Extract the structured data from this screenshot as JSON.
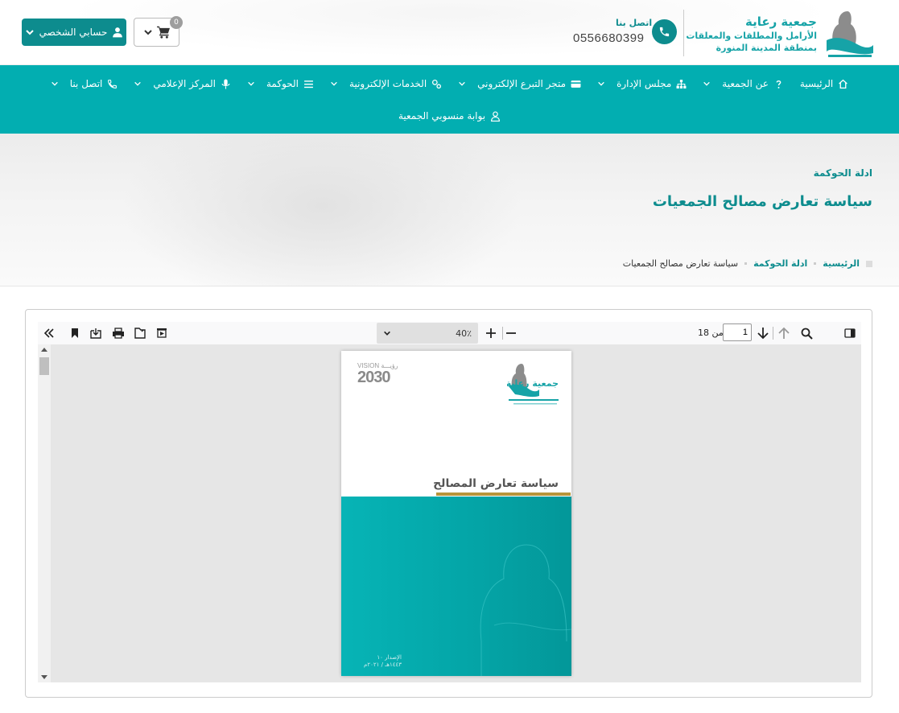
{
  "header": {
    "logo": {
      "title": "جمعية رعاية",
      "subtitle_line1": "الأرامل والمطلقات والمعلقات",
      "subtitle_line2": "بمنطقة المدينة المنورة"
    },
    "contact_label": "اتصل بنا",
    "contact_phone": "0556680399",
    "cart_count": "0",
    "account_label": "حسابي الشخصي"
  },
  "nav": {
    "row1": [
      {
        "label": "الرئيسية",
        "icon": "home-icon",
        "has_dropdown": false
      },
      {
        "label": "عن الجمعية",
        "icon": "question-icon",
        "has_dropdown": true
      },
      {
        "label": "مجلس الإدارة",
        "icon": "sitemap-icon",
        "has_dropdown": true
      },
      {
        "label": "متجر التبرع الإلكتروني",
        "icon": "card-icon",
        "has_dropdown": true
      },
      {
        "label": "الخدمات الإلكترونية",
        "icon": "gears-icon",
        "has_dropdown": true
      },
      {
        "label": "الحوكمة",
        "icon": "list-icon",
        "has_dropdown": true
      },
      {
        "label": "المركز الإعلامي",
        "icon": "mic-icon",
        "has_dropdown": true
      },
      {
        "label": "اتصل بنا",
        "icon": "phone-icon",
        "has_dropdown": true
      }
    ],
    "row2": [
      {
        "label": "بوابة منسوبي الجمعية",
        "icon": "user-icon",
        "has_dropdown": false
      }
    ]
  },
  "hero": {
    "category": "ادلة الحوكمة",
    "title": "سياسة تعارض مصالح الجمعيات",
    "breadcrumb": [
      "الرئيسية",
      "ادلة الحوكمة",
      "سياسة تعارض مصالح الجمعيات"
    ]
  },
  "viewer": {
    "zoom_value": "40٪",
    "page_current": "1",
    "page_of": "من 18",
    "document": {
      "vision_label": "VISION رؤيـــة",
      "vision_year": "2030",
      "logo_name": "جمعية رعاية",
      "title": "سياسة تعارض المصالح",
      "footer_line1": "الإصدار ١٠",
      "footer_line2": "١٤٤٣هـ / ٢٠٢١م"
    }
  },
  "colors": {
    "brand_teal": "#02aeb1",
    "dark_teal": "#0d8c8e",
    "gold": "#b8953a"
  }
}
